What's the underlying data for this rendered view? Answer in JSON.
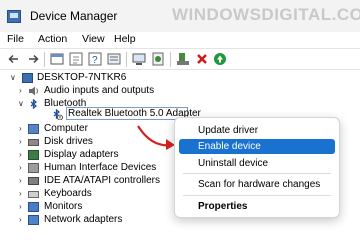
{
  "window": {
    "title": "Device Manager",
    "watermark": "WINDOWSDIGITAL.COM"
  },
  "menu": [
    "File",
    "Action",
    "View",
    "Help"
  ],
  "toolbar": {
    "buttons": [
      "back-arrow-icon",
      "forward-arrow-icon",
      "properties-icon",
      "refresh-icon",
      "help-icon",
      "resources-icon",
      "scan-hardware-icon",
      "update-driver-icon",
      "uninstall-icon",
      "enable-device-icon"
    ]
  },
  "tree": {
    "root": "DESKTOP-7NTKR6",
    "items": [
      {
        "label": "Audio inputs and outputs",
        "icon": "speaker-icon"
      },
      {
        "label": "Bluetooth",
        "icon": "bluetooth-icon",
        "expanded": true
      },
      {
        "label": "Realtek Bluetooth 5.0 Adapter",
        "icon": "bluetooth-disabled-icon",
        "child": true,
        "selected": true
      },
      {
        "label": "Computer",
        "icon": "computer-icon"
      },
      {
        "label": "Disk drives",
        "icon": "disk-drive-icon"
      },
      {
        "label": "Display adapters",
        "icon": "display-adapter-icon"
      },
      {
        "label": "Human Interface Devices",
        "icon": "hid-icon"
      },
      {
        "label": "IDE ATA/ATAPI controllers",
        "icon": "ide-controller-icon"
      },
      {
        "label": "Keyboards",
        "icon": "keyboard-icon"
      },
      {
        "label": "Monitors",
        "icon": "monitor-icon"
      },
      {
        "label": "Network adapters",
        "icon": "network-adapter-icon"
      }
    ]
  },
  "context_menu": {
    "items": [
      "Update driver",
      "Enable device",
      "Uninstall device",
      "Scan for hardware changes",
      "Properties"
    ],
    "highlighted": "Enable device"
  },
  "colors": {
    "accent": "#1a72d0",
    "arrow": "#d62020",
    "titlebar": "#f3f3f3"
  }
}
